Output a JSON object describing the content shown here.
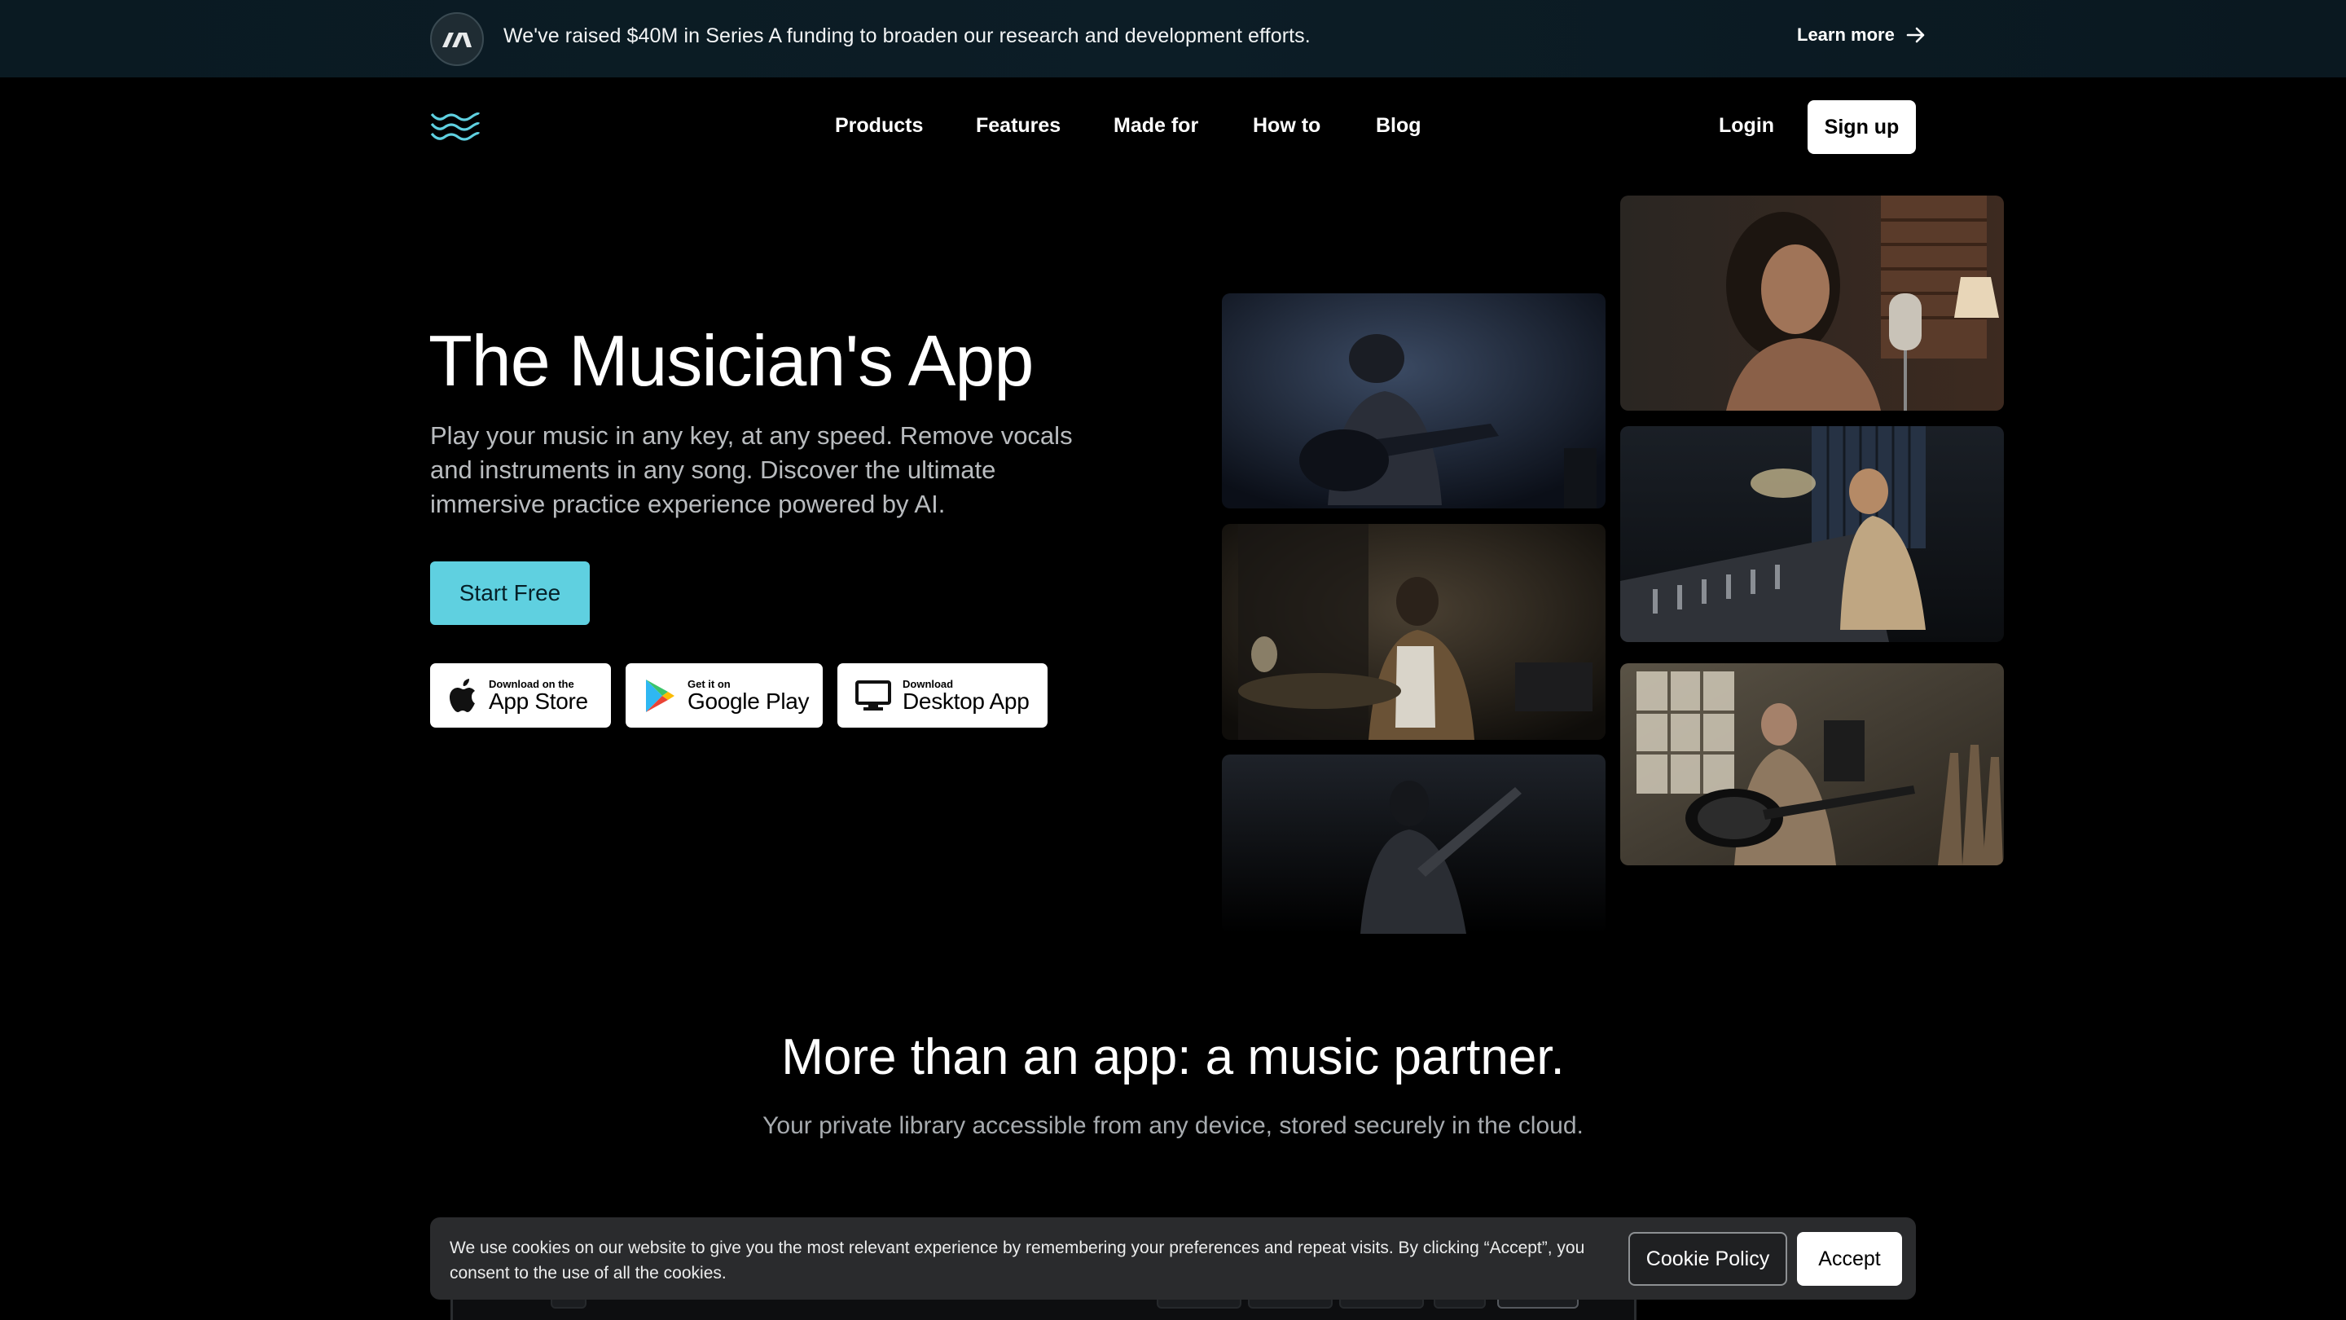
{
  "announcement": {
    "text": "We've raised $40M in Series A funding to broaden our research and development efforts.",
    "link_label": "Learn more",
    "logo_icon": "company-mark-icon",
    "arrow_icon": "arrow-right-icon"
  },
  "nav": {
    "logo_icon": "wave-logo-icon",
    "links": [
      "Products",
      "Features",
      "Made for",
      "How to",
      "Blog"
    ],
    "login": "Login",
    "signup": "Sign up"
  },
  "hero": {
    "title": "The Musician's App",
    "subtitle": "Play your music in any key, at any speed. Remove vocals and instruments in any song. Discover the ultimate immersive practice experience powered by AI.",
    "cta": "Start Free",
    "stores": [
      {
        "small": "Download on the",
        "big": "App Store",
        "icon": "apple-icon"
      },
      {
        "small": "Get it on",
        "big": "Google Play",
        "icon": "google-play-icon"
      },
      {
        "small": "Download",
        "big": "Desktop App",
        "icon": "desktop-monitor-icon"
      }
    ]
  },
  "gallery": {
    "images": [
      {
        "subject": "guitarist",
        "icon": "photo-guitarist"
      },
      {
        "subject": "singer",
        "icon": "photo-singer"
      },
      {
        "subject": "drummer",
        "icon": "photo-drummer"
      },
      {
        "subject": "producer",
        "icon": "photo-producer"
      },
      {
        "subject": "bassist",
        "icon": "photo-bassist"
      },
      {
        "subject": "studio-guitarist",
        "icon": "photo-studio-guitarist"
      }
    ]
  },
  "section2": {
    "title": "More than an app: a music partner.",
    "subtitle": "Your private library accessible from any device, stored securely in the cloud."
  },
  "cookie": {
    "text": "We use cookies on our website to give you the most relevant experience by remembering your preferences and repeat visits. By clicking “Accept”, you consent to the use of all the cookies.",
    "policy_label": "Cookie Policy",
    "accept_label": "Accept"
  },
  "colors": {
    "accent": "#5fd0e0",
    "background": "#000000",
    "announcement_bg": "#0c1d26",
    "cookie_bg": "#2a2b2d"
  }
}
